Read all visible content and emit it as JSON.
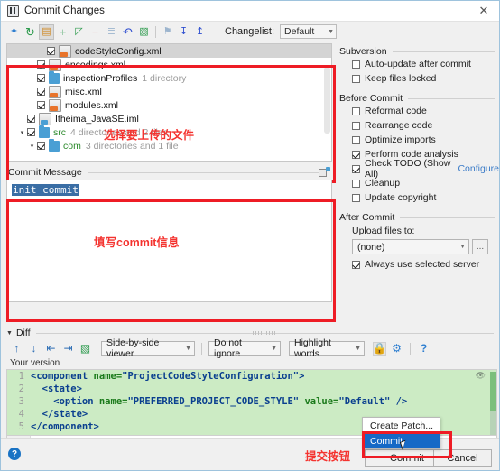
{
  "window": {
    "title": "Commit Changes",
    "close_label": "✕",
    "app_icon": "idea-icon"
  },
  "toolbar": {
    "icons": [
      {
        "name": "magic-wand-icon",
        "glyph": "✦"
      },
      {
        "name": "refresh-icon",
        "glyph": "↻"
      },
      {
        "name": "show-diff-icon",
        "glyph": "▤"
      },
      {
        "name": "add-icon",
        "glyph": "+"
      },
      {
        "name": "move-to-changelist-icon",
        "glyph": "◰"
      },
      {
        "name": "remove-icon",
        "glyph": "−"
      },
      {
        "name": "group-by-icon",
        "glyph": "≣"
      },
      {
        "name": "revert-icon",
        "glyph": "↶"
      },
      {
        "name": "edit-source-icon",
        "glyph": "▧"
      },
      {
        "name": "flag-icon",
        "glyph": "⚑"
      },
      {
        "name": "collapse-all-icon",
        "glyph": "↧"
      },
      {
        "name": "expand-all-icon",
        "glyph": "↥"
      }
    ],
    "changelist_label": "Changelist:",
    "changelist_value": "Default"
  },
  "file_tree": {
    "rows": [
      {
        "indent": 3,
        "checked": true,
        "icon": "xml-file-icon",
        "name": "codeStyleConfig.xml",
        "meta": "",
        "highlight": true,
        "arrow": ""
      },
      {
        "indent": 2,
        "checked": true,
        "icon": "xml-file-icon",
        "name": "encodings.xml",
        "meta": "",
        "highlight": false,
        "arrow": ""
      },
      {
        "indent": 2,
        "checked": true,
        "icon": "folder-icon",
        "name": "inspectionProfiles",
        "meta": "1 directory",
        "highlight": false,
        "arrow": ""
      },
      {
        "indent": 2,
        "checked": true,
        "icon": "xml-file-icon",
        "name": "misc.xml",
        "meta": "",
        "highlight": false,
        "arrow": ""
      },
      {
        "indent": 2,
        "checked": true,
        "icon": "xml-file-icon",
        "name": "modules.xml",
        "meta": "",
        "highlight": false,
        "arrow": ""
      },
      {
        "indent": 1,
        "checked": true,
        "icon": "iml-file-icon",
        "name": "Itheima_JavaSE.iml",
        "meta": "",
        "highlight": false,
        "arrow": ""
      },
      {
        "indent": 0,
        "checked": true,
        "icon": "folder-icon",
        "name": "src",
        "meta": "4 directories and 2 files",
        "highlight": false,
        "arrow": "▾",
        "green": true
      },
      {
        "indent": 1,
        "checked": true,
        "icon": "folder-icon",
        "name": "com",
        "meta": "3 directories and 1 file",
        "highlight": false,
        "arrow": "▾",
        "green": true
      }
    ],
    "annotation": "选择要上传的文件"
  },
  "commit_message": {
    "header": "Commit Message",
    "value": "init commit",
    "annotation": "填写commit信息",
    "icon": "open-message-history-icon"
  },
  "right_panel": {
    "subversion": {
      "title": "Subversion",
      "options": [
        {
          "label": "Auto-update after commit",
          "checked": false
        },
        {
          "label": "Keep files locked",
          "checked": false
        }
      ]
    },
    "before_commit": {
      "title": "Before Commit",
      "options": [
        {
          "label": "Reformat code",
          "checked": false
        },
        {
          "label": "Rearrange code",
          "checked": false
        },
        {
          "label": "Optimize imports",
          "checked": false
        },
        {
          "label": "Perform code analysis",
          "checked": true
        },
        {
          "label": "Check TODO (Show All)",
          "checked": true,
          "link": "Configure"
        },
        {
          "label": "Cleanup",
          "checked": false
        },
        {
          "label": "Update copyright",
          "checked": false
        }
      ]
    },
    "after_commit": {
      "title": "After Commit",
      "upload_label": "Upload files to:",
      "upload_value": "(none)",
      "browse_label": "...",
      "always_use": {
        "label": "Always use selected server",
        "checked": true
      }
    }
  },
  "diff": {
    "header": "Diff",
    "buttons": [
      {
        "name": "previous-difference-icon",
        "glyph": "↑"
      },
      {
        "name": "next-difference-icon",
        "glyph": "↓"
      },
      {
        "name": "accept-left-icon",
        "glyph": "⇥"
      },
      {
        "name": "accept-right-icon",
        "glyph": "⇤"
      },
      {
        "name": "edit-source-icon",
        "glyph": "▧"
      }
    ],
    "viewer_mode": "Side-by-side viewer",
    "ignore_mode": "Do not ignore",
    "highlight_mode": "Highlight words",
    "lock_icon": "lock-icon",
    "settings_icon": "gear-icon",
    "help_icon": "question-mark-icon",
    "pane_label": "Your version",
    "code_lines": [
      {
        "n": "1",
        "indent": 0,
        "parts": [
          {
            "t": "<component ",
            "c": "tg"
          },
          {
            "t": "name=",
            "c": "at"
          },
          {
            "t": "\"ProjectCodeStyleConfiguration\">",
            "c": "vl"
          }
        ]
      },
      {
        "n": "2",
        "indent": 1,
        "parts": [
          {
            "t": "<state>",
            "c": "tg"
          }
        ]
      },
      {
        "n": "3",
        "indent": 2,
        "parts": [
          {
            "t": "<option ",
            "c": "tg"
          },
          {
            "t": "name=",
            "c": "at"
          },
          {
            "t": "\"PREFERRED_PROJECT_CODE_STYLE\" ",
            "c": "vl"
          },
          {
            "t": "value=",
            "c": "at"
          },
          {
            "t": "\"Default\" />",
            "c": "vl"
          }
        ]
      },
      {
        "n": "4",
        "indent": 1,
        "parts": [
          {
            "t": "</state>",
            "c": "tg"
          }
        ]
      },
      {
        "n": "5",
        "indent": 0,
        "parts": [
          {
            "t": "</component>",
            "c": "tg"
          }
        ]
      }
    ]
  },
  "footer": {
    "help_label": "?",
    "annotation": "提交按钮",
    "commit_label": "Commit",
    "cancel_label": "Cancel",
    "popup": [
      {
        "label": "Create Patch...",
        "selected": false
      },
      {
        "label": "Commit",
        "selected": true
      }
    ]
  },
  "colors": {
    "annotation_red": "#f4332f",
    "highlight_box": "#ee1c25",
    "diff_added": "#ccebc4",
    "selection_blue": "#3a6ea5",
    "link_blue": "#3a7bc8"
  }
}
